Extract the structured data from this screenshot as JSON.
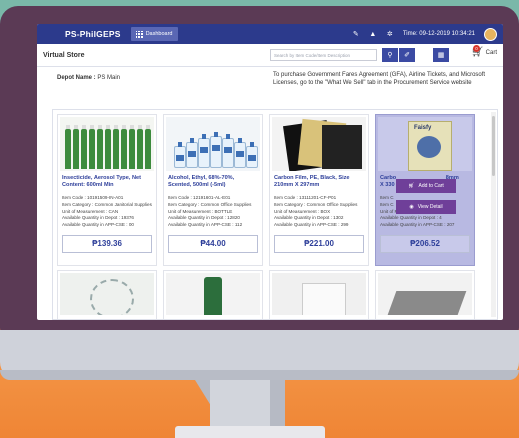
{
  "app": {
    "brand": "PS-PhilGEPS",
    "dashboard_label": "Dashboard",
    "datetime": "Time: 09-12-2019 10:34:21"
  },
  "page": {
    "title": "Virtual Store",
    "search_placeholder": "Search by Item Code/Item Description",
    "cart_label": "Cart",
    "cart_count": "0",
    "depot_label": "Depot Name :",
    "depot_value": "PS Main",
    "notice": "To purchase Government Fares Agreement (GFA), Airline Tickets, and Microsoft Licenses, go to the \"What We Sell\" tab in the Procurement Service website"
  },
  "products": [
    {
      "name": "Insecticide, Aerosol Type, Net Content: 600ml Min",
      "code": "Item Code : 10191509-IN-A01",
      "category": "Item Category : Common Janitorial Supplies",
      "unit": "Unit of Measurement : CAN",
      "qty_depot": "Available Quantity in Depot : 19376",
      "qty_app": "Available Quantity in APP-CSE : 00",
      "price": "₱139.36"
    },
    {
      "name": "Alcohol, Ethyl, 68%-70%, Scented, 500ml (-5ml)",
      "code": "Item Code : 12191601-AL-E01",
      "category": "Item Category : Common Office Supplies",
      "unit": "Unit of Measurement : BOTTLE",
      "qty_depot": "Available Quantity in Depot : 12820",
      "qty_app": "Available Quantity in APP-CSE : 112",
      "price": "₱44.00"
    },
    {
      "name": "Carbon Film, PE, Black, Size 210mm X 297mm",
      "code": "Item Code : 13111201-CF-P01",
      "category": "Item Category : Common Office Supplies",
      "unit": "Unit of Measurement : BOX",
      "qty_depot": "Available Quantity in Depot : 1302",
      "qty_app": "Available Quantity in APP-CSE : 299",
      "price": "₱221.00"
    },
    {
      "name": "Carbo",
      "name_tail": "8mm",
      "name_line2": "X 330",
      "code": "Item C",
      "category": "Item C",
      "unit": "Unit of Measurement : BOX",
      "qty_depot": "Available Quantity in Depot : 4",
      "qty_app": "Available Quantity in APP-CSE : 207",
      "price": "₱206.52",
      "book_label": "Faisfy",
      "add_to_cart": "Add to Cart",
      "view_detail": "View Detail"
    }
  ],
  "icons": {
    "grid": "grid-icon",
    "notification": "bell-icon",
    "user": "user-icon",
    "settings": "gear-icon",
    "search": "search-icon",
    "clear": "eraser-icon",
    "view_grid": "grid-view-icon",
    "cart": "cart-icon"
  },
  "colors": {
    "topbar": "#2c3a8c",
    "accent": "#3b4aa3",
    "overlay": "#6f3f99",
    "price_text": "#2e3f9a"
  }
}
